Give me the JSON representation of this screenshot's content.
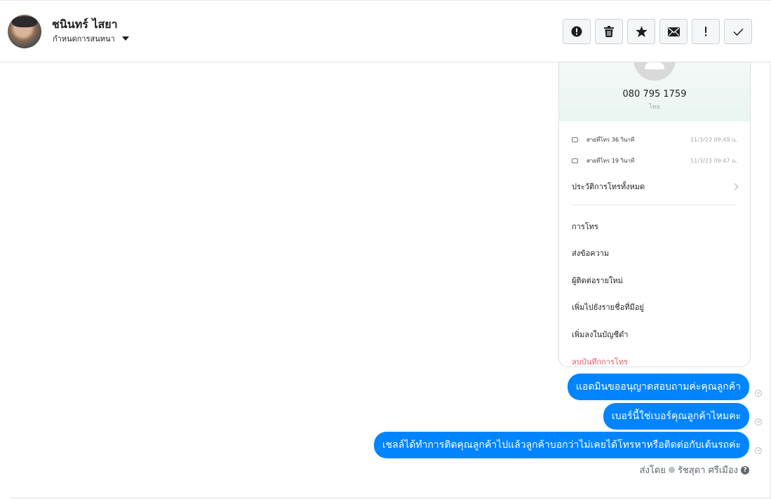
{
  "header": {
    "contact_name": "ชนินทร์ ไสยา",
    "assign_label": "กำหนดการสนทนา",
    "actions": [
      {
        "name": "mark-spam-button",
        "icon": "alert-circle-icon"
      },
      {
        "name": "delete-button",
        "icon": "trash-icon"
      },
      {
        "name": "star-button",
        "icon": "star-icon"
      },
      {
        "name": "mark-unread-button",
        "icon": "envelope-icon"
      },
      {
        "name": "follow-up-button",
        "icon": "exclamation-icon"
      },
      {
        "name": "mark-done-button",
        "icon": "check-icon"
      }
    ]
  },
  "screenshot": {
    "phone_number": "080 795 1759",
    "region": "ไทย",
    "calls": [
      {
        "label": "สายที่โทร  36 วินาที",
        "time": "11/3/23 09:49 น."
      },
      {
        "label": "สายที่โทร  19 วินาที",
        "time": "11/3/23 09:47 น."
      }
    ],
    "history_label": "ประวัติการโทรทั้งหมด",
    "menu": [
      "การโทร",
      "ส่งข้อความ",
      "ผู้ติดต่อรายใหม่",
      "เพิ่มไปยังรายชื่อที่มีอยู่",
      "เพิ่มลงในบัญชีดำ",
      "ลบบันทึกการโทร"
    ]
  },
  "messages": [
    "แอดมินขออนุญาตสอบถามค่ะคุณลูกค้า",
    "เบอร์นี้ใช่เบอร์คุณลูกค้าไหมคะ",
    "เชลล์ได้ทำการติดคุณลูกค้าไปแล้วลูกค้าบอกว่าไม่เคยได้โทรหาหรือติดต่อกับเต้นรถค่ะ"
  ],
  "sent_by": {
    "prefix": "ส่งโดย",
    "agent": "รัชสุดา ศรีเมือง",
    "help": "?"
  },
  "colors": {
    "bubble": "#0084ff",
    "delete_option": "#e05a6a"
  }
}
